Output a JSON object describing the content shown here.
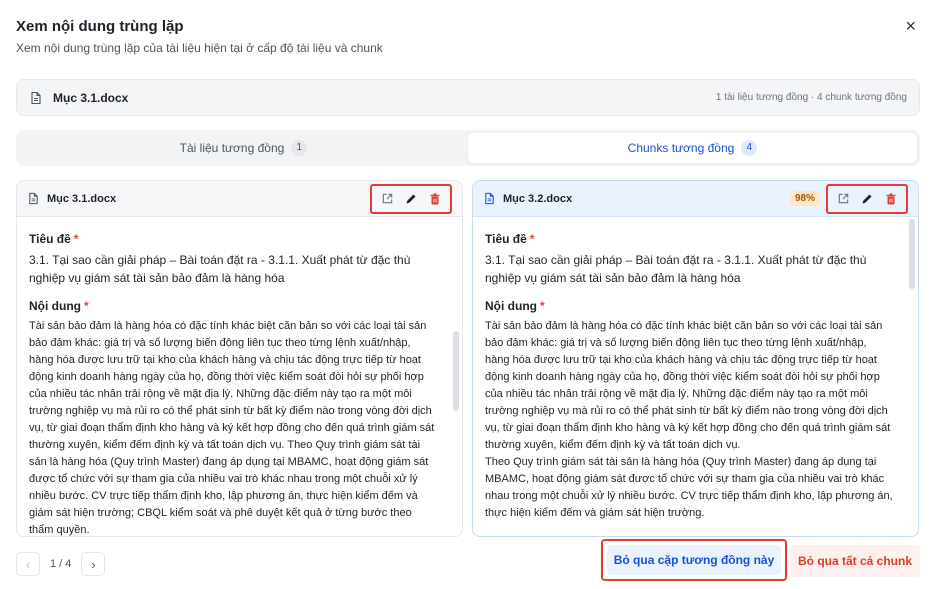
{
  "dialog": {
    "title": "Xem nội dung trùng lặp",
    "subtitle": "Xem nội dung trùng lặp của tài liệu hiện tại ở cấp độ tài liệu và chunk",
    "close_icon": "×"
  },
  "file_bar": {
    "file_name": "Mục 3.1.docx",
    "summary": "1 tài liệu tương đồng · 4 chunk tương đồng"
  },
  "tabs": [
    {
      "label": "Tài liệu tương đồng",
      "count": "1",
      "active": false
    },
    {
      "label": "Chunks tương đồng",
      "count": "4",
      "active": true
    }
  ],
  "left_panel": {
    "file_name": "Mục 3.1.docx",
    "title_label": "Tiêu đề",
    "title_value": "3.1. Tại sao cần giải pháp – Bài toán đặt ra - 3.1.1. Xuất phát từ đặc thù nghiệp vụ giám sát tài sản bảo đảm là hàng hóa",
    "content_label": "Nội dung",
    "content_value": "Tài sản bảo đảm là hàng hóa có đặc tính khác biệt căn bản so với các loại tài sản bảo đảm khác: giá trị và số lượng biến động liên tục theo từng lệnh xuất/nhập, hàng hóa được lưu trữ tại kho của khách hàng và chịu tác động trực tiếp từ hoạt động kinh doanh hàng ngày của họ, đồng thời việc kiểm soát đòi hỏi sự phối hợp của nhiều tác nhân trải rộng về mặt địa lý. Những đặc điểm này tạo ra một môi trường nghiệp vụ mà rủi ro có thể phát sinh từ bất kỳ điểm nào trong vòng đời dịch vụ, từ giai đoạn thẩm định kho hàng và ký kết hợp đồng cho đến quá trình giám sát thường xuyên, kiểm đếm định kỳ và tất toán dịch vụ. Theo Quy trình giám sát tài sản là hàng hóa (Quy trình Master) đang áp dụng tại MBAMC, hoạt động giám sát được tổ chức với sự tham gia của nhiều vai trò khác nhau trong một chuỗi xử lý nhiều bước. CV trực tiếp thẩm định kho, lập phương án, thực hiện kiểm đếm và giám sát hiện trường; CBQL kiểm soát và phê duyệt kết quả ở từng bước theo thẩm quyền.",
    "required_mark": "*"
  },
  "right_panel": {
    "file_name": "Mục 3.2.docx",
    "score": "98%",
    "title_label": "Tiêu đề",
    "title_value": "3.1. Tại sao cần giải pháp – Bài toán đặt ra - 3.1.1. Xuất phát từ đặc thù nghiệp vụ giám sát tài sản bảo đảm là hàng hóa",
    "content_label": "Nội dung",
    "content_value": "Tài sản bảo đảm là hàng hóa có đặc tính khác biệt căn bản so với các loại tài sản bảo đảm khác: giá trị và số lượng biến động liên tục theo từng lệnh xuất/nhập, hàng hóa được lưu trữ tại kho của khách hàng và chịu tác động trực tiếp từ hoạt động kinh doanh hàng ngày của họ, đồng thời việc kiểm soát đòi hỏi sự phối hợp của nhiều tác nhân trải rộng về mặt địa lý. Những đặc điểm này tạo ra một môi trường nghiệp vụ mà rủi ro có thể phát sinh từ bất kỳ điểm nào trong vòng đời dịch vụ, từ giai đoạn thẩm định kho hàng và ký kết hợp đồng cho đến quá trình giám sát thường xuyên, kiểm đếm định kỳ và tất toán dịch vụ.\nTheo Quy trình giám sát tài sản là hàng hóa (Quy trình Master) đang áp dụng tại MBAMC, hoạt động giám sát được tổ chức với sự tham gia của nhiều vai trò khác nhau trong một chuỗi xử lý nhiều bước. CV trực tiếp thẩm định kho, lập phương án, thực hiện kiểm đếm và giám sát hiện trường.",
    "required_mark": "*"
  },
  "pager": {
    "text": "1 / 4",
    "prev_icon": "‹",
    "next_icon": "›"
  },
  "footer": {
    "skip_pair_label": "Bỏ qua cặp tương đồng này",
    "skip_all_label": "Bỏ qua tất cả chunk"
  },
  "colors": {
    "accent": "#1d4ed8",
    "danger": "#e53935",
    "score_bg": "#fde7c7"
  }
}
